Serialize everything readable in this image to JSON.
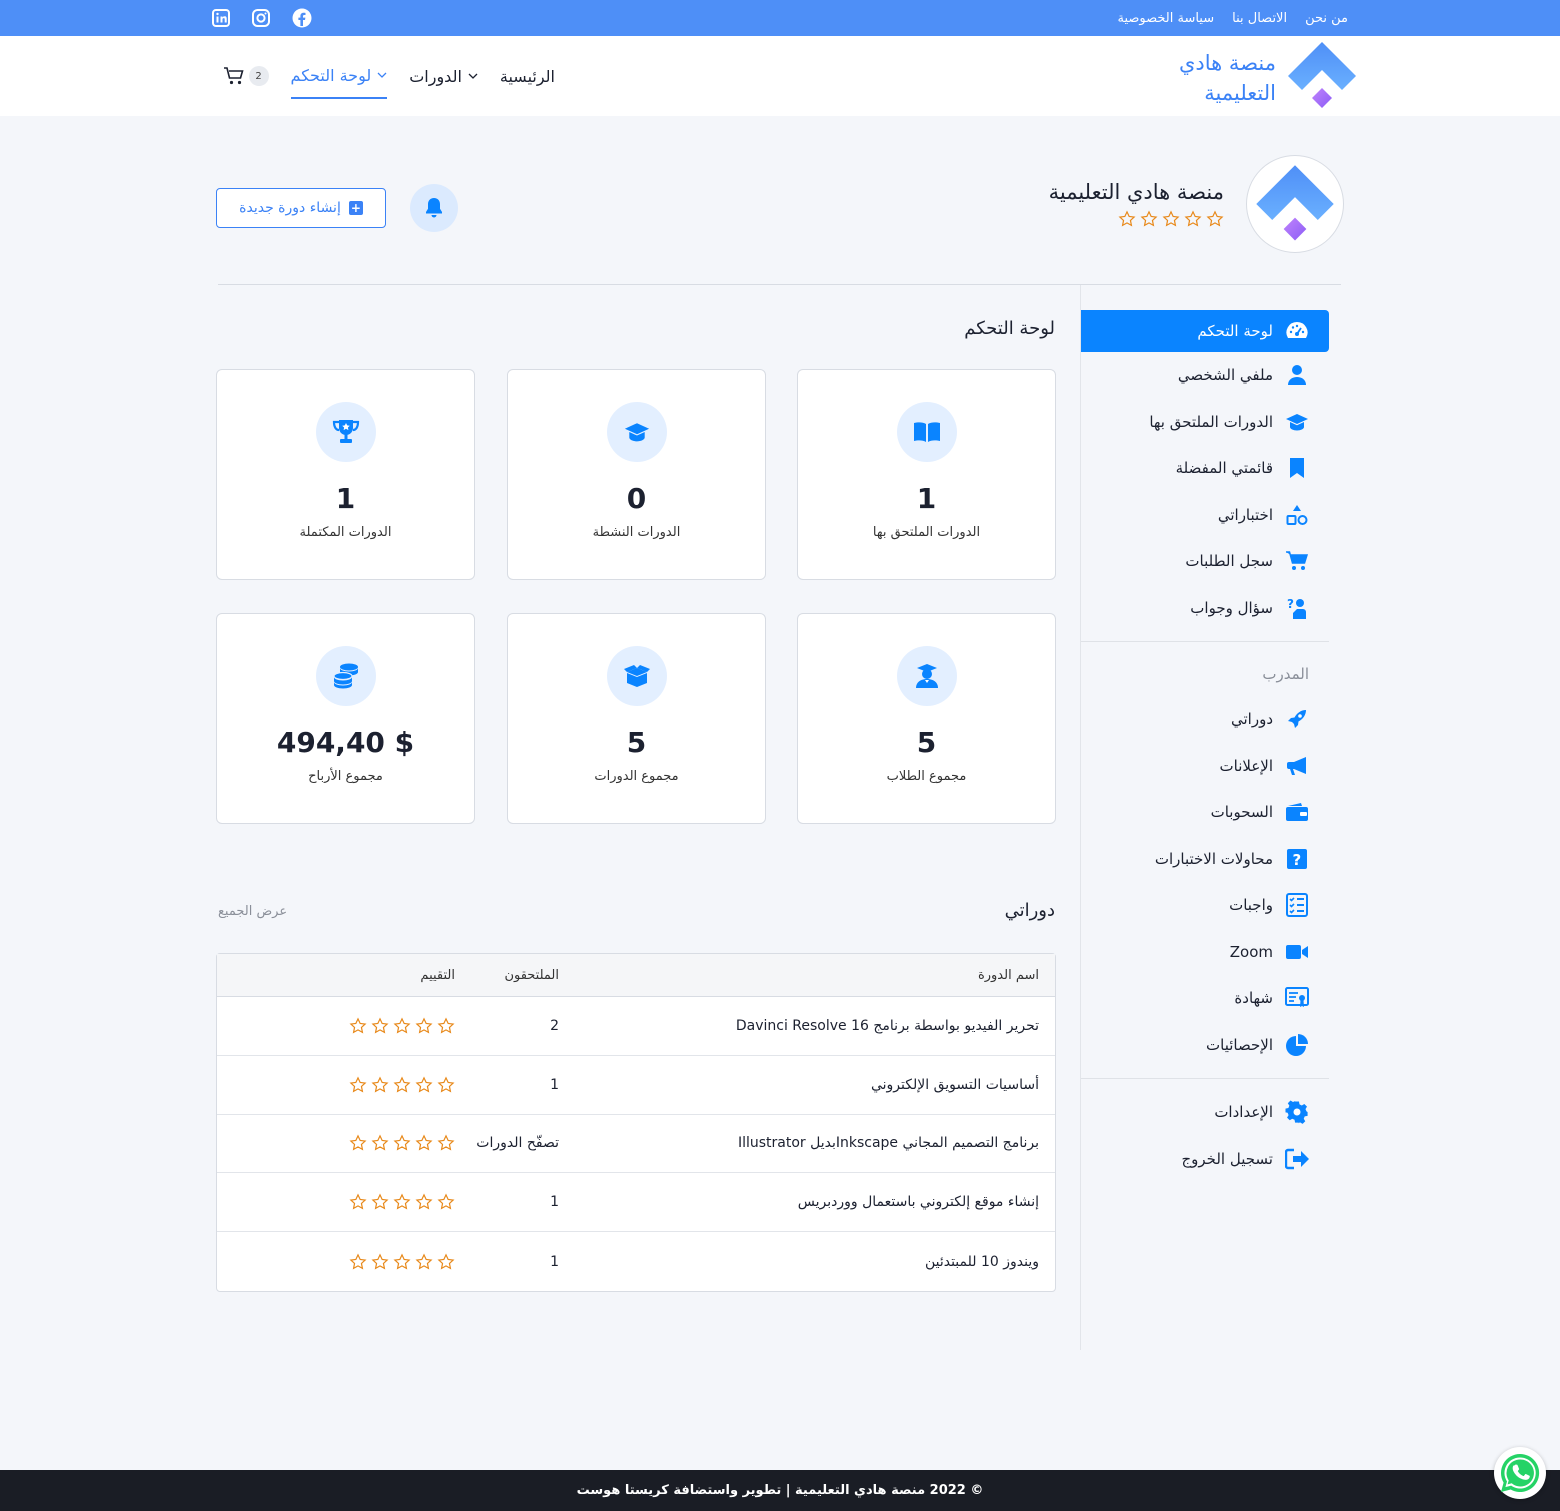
{
  "topbar": {
    "links": [
      "من نحن",
      "الاتصال بنا",
      "سياسة الخصوصية"
    ],
    "social": [
      "facebook-icon",
      "instagram-icon",
      "linkedin-icon"
    ],
    "color": "#4e8ff7"
  },
  "header": {
    "brand_line1": "منصة هادي",
    "brand_line2": "التعليمية",
    "nav": {
      "home": "الرئيسية",
      "courses": "الدورات",
      "dashboard": "لوحة التحكم"
    },
    "cart_count": "2"
  },
  "profile": {
    "name": "منصة هادي التعليمية",
    "rating_stars": 5,
    "new_course_label": "إنشاء دورة جديدة"
  },
  "sidebar": {
    "items": [
      {
        "label": "لوحة التحكم",
        "icon": "dashboard-icon"
      },
      {
        "label": "ملفي الشخصي",
        "icon": "user-icon"
      },
      {
        "label": "الدورات الملتحق بها",
        "icon": "graduation-cap-icon"
      },
      {
        "label": "قائمتي المفضلة",
        "icon": "bookmark-icon"
      },
      {
        "label": "اختباراتي",
        "icon": "quiz-shapes-icon"
      },
      {
        "label": "سجل الطلبات",
        "icon": "cart-icon"
      },
      {
        "label": "سؤال وجواب",
        "icon": "question-answer-icon"
      }
    ],
    "instructor_heading": "المدرب",
    "instructor_items": [
      {
        "label": "دوراتي",
        "icon": "rocket-icon"
      },
      {
        "label": "الإعلانات",
        "icon": "megaphone-icon"
      },
      {
        "label": "السحوبات",
        "icon": "wallet-icon"
      },
      {
        "label": "محاولات الاختبارات",
        "icon": "question-box-icon"
      },
      {
        "label": "واجبات",
        "icon": "assignment-icon"
      },
      {
        "label": "Zoom",
        "icon": "video-camera-icon"
      },
      {
        "label": "شهادة",
        "icon": "certificate-icon"
      },
      {
        "label": "الإحصائيات",
        "icon": "pie-chart-icon"
      }
    ],
    "settings": {
      "label": "الإعدادات",
      "icon": "gear-icon"
    },
    "logout": {
      "label": "تسجيل الخروج",
      "icon": "logout-icon"
    },
    "active_color": "#0a84ff"
  },
  "dashboard": {
    "title": "لوحة التحكم",
    "cards": [
      {
        "value": "1",
        "label": "الدورات الملتحق بها",
        "icon": "open-book-icon"
      },
      {
        "value": "0",
        "label": "الدورات النشطة",
        "icon": "graduation-cap-icon"
      },
      {
        "value": "1",
        "label": "الدورات المكتملة",
        "icon": "trophy-icon"
      },
      {
        "value": "5",
        "label": "مجموع الطلاب",
        "icon": "student-icon"
      },
      {
        "value": "5",
        "label": "مجموع الدورات",
        "icon": "box-icon"
      },
      {
        "value": "494,40 $",
        "label": "مجموع الأرباح",
        "icon": "coins-icon"
      }
    ]
  },
  "courses": {
    "title": "دوراتي",
    "view_all": "عرض الجميع",
    "headers": {
      "name": "اسم الدورة",
      "enrolled": "الملتحقون",
      "rating": "التقييم"
    },
    "rows": [
      {
        "name": "تحرير الفيديو بواسطة برنامج Davinci Resolve 16",
        "enrolled": "2"
      },
      {
        "name": "أساسيات التسويق الإلكتروني",
        "enrolled": "1"
      },
      {
        "name": "برنامج التصميم المجاني Inkscapeبديل Illustrator",
        "enrolled": "تصفّح الدورات"
      },
      {
        "name": "إنشاء موقع إلكتروني باستعمال ووردبريس",
        "enrolled": "1"
      },
      {
        "name": "ويندوز 10 للمبتدئين",
        "enrolled": "1"
      }
    ]
  },
  "footer": {
    "text": "© 2022 منصة هادي التعليمية | تطوير واستضافة كريستا هوست"
  },
  "colors": {
    "accent": "#3b82f6",
    "star": "#e8891a",
    "footer_bg": "#1a1d25"
  }
}
